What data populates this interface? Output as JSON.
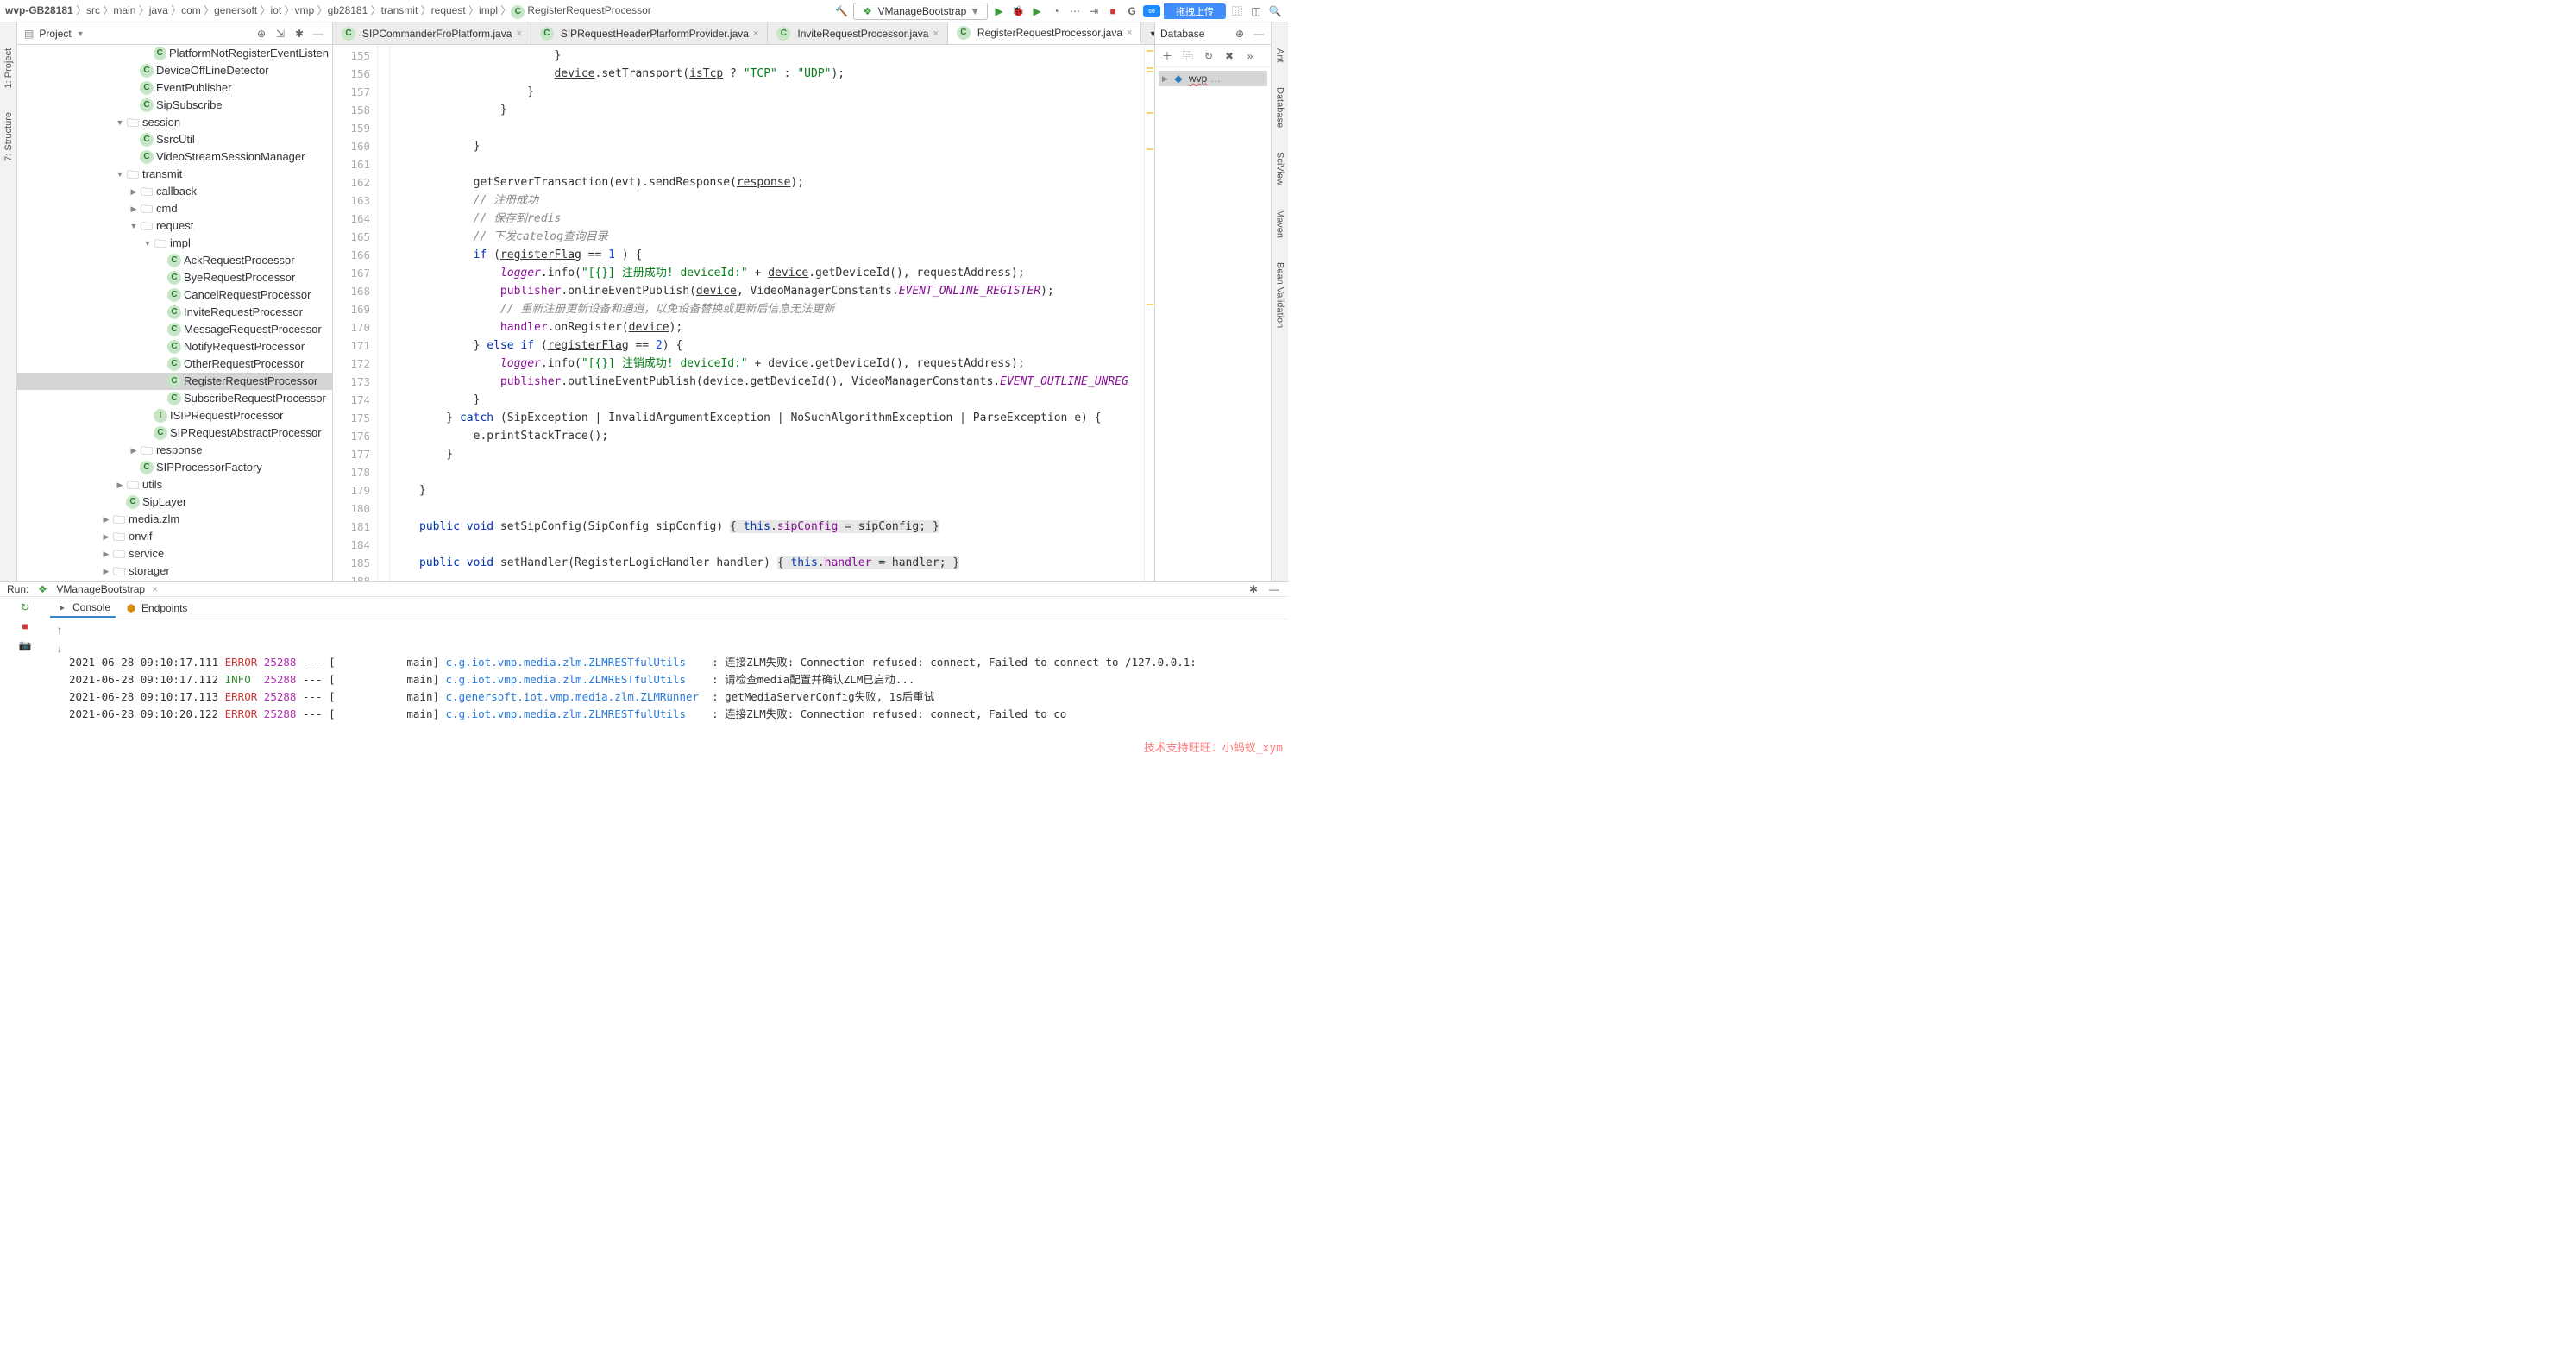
{
  "breadcrumb": [
    "wvp-GB28181",
    "src",
    "main",
    "java",
    "com",
    "genersoft",
    "iot",
    "vmp",
    "gb28181",
    "transmit",
    "request",
    "impl",
    "RegisterRequestProcessor"
  ],
  "breadcrumb_icon_last": "class-icon",
  "run_config": {
    "label": "VManageBootstrap"
  },
  "top_buttons": {
    "share_badge": "∞",
    "share_btn": "拖拽上传"
  },
  "left_tool_buttons": [
    "1: Project",
    "7: Structure"
  ],
  "right_tool_buttons": [
    "Ant",
    "Database",
    "SciView",
    "Maven",
    "Bean Validation"
  ],
  "project_panel": {
    "title": "Project",
    "tree": [
      {
        "indent": 9,
        "icon": "C",
        "cls": "ic-class",
        "label": "PlatformNotRegisterEventListen"
      },
      {
        "indent": 8,
        "icon": "C",
        "cls": "ic-class",
        "label": "DeviceOffLineDetector"
      },
      {
        "indent": 8,
        "icon": "C",
        "cls": "ic-class",
        "label": "EventPublisher"
      },
      {
        "indent": 8,
        "icon": "C",
        "cls": "ic-class",
        "label": "SipSubscribe"
      },
      {
        "indent": 7,
        "arrow": "▼",
        "icon": "▸",
        "cls": "ic-folder",
        "label": "session"
      },
      {
        "indent": 8,
        "icon": "C",
        "cls": "ic-class",
        "label": "SsrcUtil"
      },
      {
        "indent": 8,
        "icon": "C",
        "cls": "ic-class",
        "label": "VideoStreamSessionManager"
      },
      {
        "indent": 7,
        "arrow": "▼",
        "icon": "▸",
        "cls": "ic-folder",
        "label": "transmit"
      },
      {
        "indent": 8,
        "arrow": "▶",
        "icon": "▸",
        "cls": "ic-folder",
        "label": "callback"
      },
      {
        "indent": 8,
        "arrow": "▶",
        "icon": "▸",
        "cls": "ic-folder",
        "label": "cmd"
      },
      {
        "indent": 8,
        "arrow": "▼",
        "icon": "▸",
        "cls": "ic-folder",
        "label": "request"
      },
      {
        "indent": 9,
        "arrow": "▼",
        "icon": "▸",
        "cls": "ic-folder",
        "label": "impl"
      },
      {
        "indent": 10,
        "icon": "C",
        "cls": "ic-class",
        "label": "AckRequestProcessor"
      },
      {
        "indent": 10,
        "icon": "C",
        "cls": "ic-class",
        "label": "ByeRequestProcessor"
      },
      {
        "indent": 10,
        "icon": "C",
        "cls": "ic-class",
        "label": "CancelRequestProcessor"
      },
      {
        "indent": 10,
        "icon": "C",
        "cls": "ic-class",
        "label": "InviteRequestProcessor"
      },
      {
        "indent": 10,
        "icon": "C",
        "cls": "ic-class",
        "label": "MessageRequestProcessor"
      },
      {
        "indent": 10,
        "icon": "C",
        "cls": "ic-class",
        "label": "NotifyRequestProcessor"
      },
      {
        "indent": 10,
        "icon": "C",
        "cls": "ic-class",
        "label": "OtherRequestProcessor"
      },
      {
        "indent": 10,
        "icon": "C",
        "cls": "ic-class",
        "label": "RegisterRequestProcessor",
        "selected": true
      },
      {
        "indent": 10,
        "icon": "C",
        "cls": "ic-class",
        "label": "SubscribeRequestProcessor"
      },
      {
        "indent": 9,
        "icon": "I",
        "cls": "ic-iface",
        "label": "ISIPRequestProcessor"
      },
      {
        "indent": 9,
        "icon": "C",
        "cls": "ic-class",
        "label": "SIPRequestAbstractProcessor"
      },
      {
        "indent": 8,
        "arrow": "▶",
        "icon": "▸",
        "cls": "ic-folder",
        "label": "response"
      },
      {
        "indent": 8,
        "icon": "C",
        "cls": "ic-class",
        "label": "SIPProcessorFactory"
      },
      {
        "indent": 7,
        "arrow": "▶",
        "icon": "▸",
        "cls": "ic-folder",
        "label": "utils"
      },
      {
        "indent": 7,
        "icon": "C",
        "cls": "ic-class",
        "label": "SipLayer"
      },
      {
        "indent": 6,
        "arrow": "▶",
        "icon": "▸",
        "cls": "ic-folder",
        "label": "media.zlm"
      },
      {
        "indent": 6,
        "arrow": "▶",
        "icon": "▸",
        "cls": "ic-folder",
        "label": "onvif"
      },
      {
        "indent": 6,
        "arrow": "▶",
        "icon": "▸",
        "cls": "ic-folder",
        "label": "service"
      },
      {
        "indent": 6,
        "arrow": "▶",
        "icon": "▸",
        "cls": "ic-folder",
        "label": "storager"
      }
    ]
  },
  "editor_tabs": [
    {
      "label": "SIPCommanderFroPlatform.java",
      "active": false
    },
    {
      "label": "SIPRequestHeaderPlarformProvider.java",
      "active": false
    },
    {
      "label": "InviteRequestProcessor.java",
      "active": false
    },
    {
      "label": "RegisterRequestProcessor.java",
      "active": true
    }
  ],
  "gutter_start": 155,
  "gutter_end": 188,
  "code_lines": [
    {
      "n": 155,
      "html": "                    }"
    },
    {
      "n": 156,
      "html": "                    <span class='und'>device</span>.setTransport(<span class='und'>isTcp</span> ? <span class='str'>\"TCP\"</span> : <span class='str'>\"UDP\"</span>);"
    },
    {
      "n": 157,
      "html": "                }"
    },
    {
      "n": 158,
      "html": "            }"
    },
    {
      "n": 159,
      "html": ""
    },
    {
      "n": 160,
      "html": "        }"
    },
    {
      "n": 161,
      "html": ""
    },
    {
      "n": 162,
      "html": "        getServerTransaction(evt).sendResponse(<span class='und'>response</span>);"
    },
    {
      "n": 163,
      "html": "        <span class='com'>// 注册成功</span>"
    },
    {
      "n": 164,
      "html": "        <span class='com'>// 保存到redis</span>"
    },
    {
      "n": 165,
      "html": "        <span class='com'>// 下发catelog查询目录</span>"
    },
    {
      "n": 166,
      "html": "        <span class='kw'>if</span> (<span class='und'>registerFlag</span> == <span class='num'>1</span> ) {"
    },
    {
      "n": 167,
      "html": "            <span class='sfld'>logger</span>.info(<span class='str'>\"[{}] 注册成功! deviceId:\"</span> + <span class='und'>device</span>.getDeviceId(), requestAddress);"
    },
    {
      "n": 168,
      "html": "            <span class='fld'>publisher</span>.onlineEventPublish(<span class='und'>device</span>, VideoManagerConstants.<span class='sfld'>EVENT_ONLINE_REGISTER</span>);"
    },
    {
      "n": 169,
      "html": "            <span class='com'>// 重新注册更新设备和通道，以免设备替换或更新后信息无法更新</span>"
    },
    {
      "n": 170,
      "html": "            <span class='fld'>handler</span>.onRegister(<span class='und'>device</span>);"
    },
    {
      "n": 171,
      "html": "        } <span class='kw'>else if</span> (<span class='und'>registerFlag</span> == <span class='num'>2</span>) {"
    },
    {
      "n": 172,
      "html": "            <span class='sfld'>logger</span>.info(<span class='str'>\"[{}] 注销成功! deviceId:\"</span> + <span class='und'>device</span>.getDeviceId(), requestAddress);"
    },
    {
      "n": 173,
      "html": "            <span class='fld'>publisher</span>.outlineEventPublish(<span class='und'>device</span>.getDeviceId(), VideoManagerConstants.<span class='sfld'>EVENT_OUTLINE_UNREG</span>"
    },
    {
      "n": 174,
      "html": "        }"
    },
    {
      "n": 175,
      "html": "    } <span class='kw'>catch</span> (SipException | InvalidArgumentException | NoSuchAlgorithmException | ParseException e) {"
    },
    {
      "n": 176,
      "html": "        e.printStackTrace();"
    },
    {
      "n": 177,
      "html": "    }"
    },
    {
      "n": 178,
      "html": ""
    },
    {
      "n": 179,
      "html": "}"
    },
    {
      "n": 180,
      "html": ""
    },
    {
      "n": 181,
      "html": "<span class='kw'>public void</span> setSipConfig(SipConfig sipConfig) <span class='hl'>{ <span class='kw'>this</span>.<span class='fld'>sipConfig</span> = sipConfig; }</span>"
    },
    {
      "n": 184,
      "html": ""
    },
    {
      "n": 185,
      "html": "<span class='kw'>public void</span> setHandler(RegisterLogicHandler handler) <span class='hl'>{ <span class='kw'>this</span>.<span class='fld'>handler</span> = handler; }</span>"
    },
    {
      "n": 188,
      "html": ""
    }
  ],
  "database_panel": {
    "title": "Database",
    "item": "wvp",
    "item_suffix": "…"
  },
  "run_panel": {
    "title": "Run:",
    "config": "VManageBootstrap",
    "tabs": [
      "Console",
      "Endpoints"
    ],
    "log": [
      {
        "ts": "2021-06-28 09:10:17.111",
        "lvl": "ERROR",
        "pid": "25288",
        "th": "main",
        "cls": "c.g.iot.vmp.media.zlm.ZLMRESTfulUtils",
        "msg": "连接ZLM失败: Connection refused: connect, Failed to connect to /127.0.0.1:"
      },
      {
        "ts": "2021-06-28 09:10:17.112",
        "lvl": "INFO",
        "pid": "25288",
        "th": "main",
        "cls": "c.g.iot.vmp.media.zlm.ZLMRESTfulUtils",
        "msg": "请检查media配置并确认ZLM已启动..."
      },
      {
        "ts": "2021-06-28 09:10:17.113",
        "lvl": "ERROR",
        "pid": "25288",
        "th": "main",
        "cls": "c.genersoft.iot.vmp.media.zlm.ZLMRunner",
        "msg": "getMediaServerConfig失败, 1s后重试"
      },
      {
        "ts": "2021-06-28 09:10:20.122",
        "lvl": "ERROR",
        "pid": "25288",
        "th": "main",
        "cls": "c.g.iot.vmp.media.zlm.ZLMRESTfulUtils",
        "msg": "连接ZLM失败: Connection refused: connect, Failed to co"
      }
    ],
    "watermark": "技术支持旺旺：小蚂蚁_xym"
  }
}
